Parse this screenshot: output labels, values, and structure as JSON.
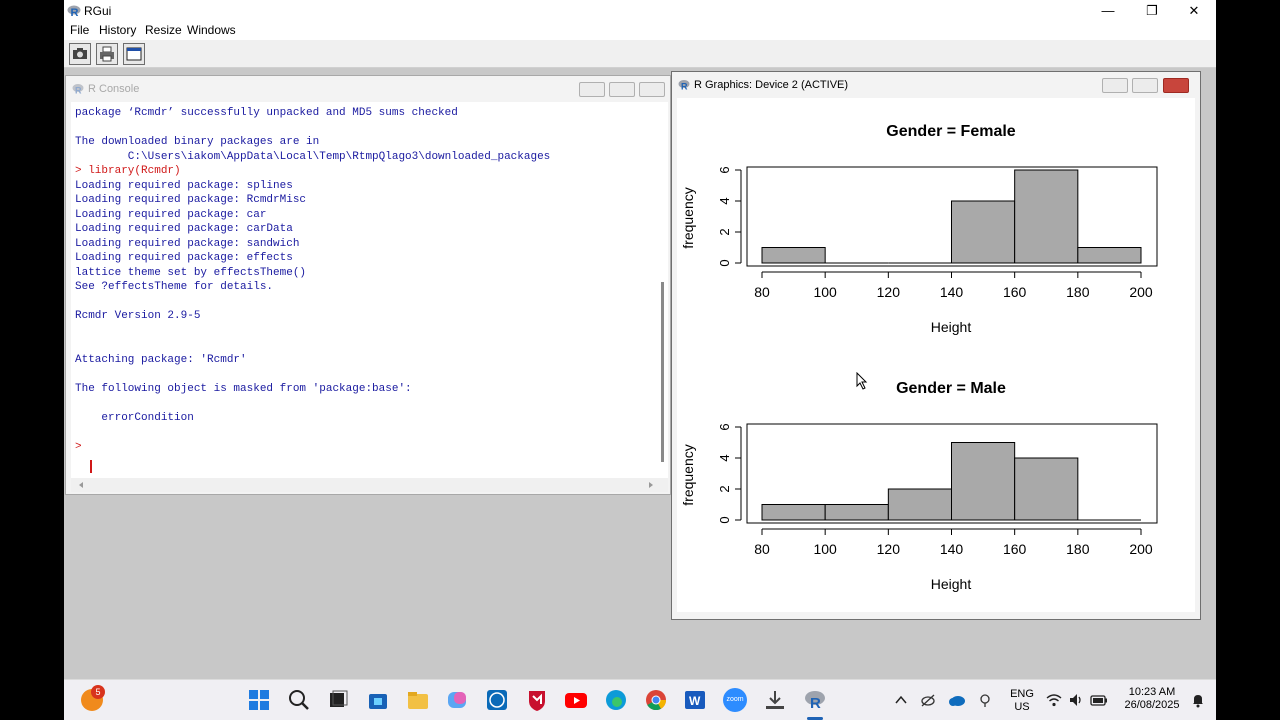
{
  "window": {
    "title": "RGui",
    "minimize": "—",
    "maximize": "❐",
    "close": "✕"
  },
  "menu": [
    "File",
    "History",
    "Resize",
    "Windows"
  ],
  "toolbar": [
    {
      "icon": "open-script-icon"
    },
    {
      "icon": "print-icon"
    },
    {
      "icon": "window-icon"
    }
  ],
  "console": {
    "title": "R Console",
    "lines": [
      {
        "text": "package ‘Rcmdr’ successfully unpacked and MD5 sums checked",
        "color": "blue"
      },
      {
        "text": "",
        "color": "blue"
      },
      {
        "text": "The downloaded binary packages are in",
        "color": "blue"
      },
      {
        "text": "        C:\\Users\\iakom\\AppData\\Local\\Temp\\RtmpQlago3\\downloaded_packages",
        "color": "blue"
      },
      {
        "text": "> library(Rcmdr)",
        "color": "red"
      },
      {
        "text": "Loading required package: splines",
        "color": "blue"
      },
      {
        "text": "Loading required package: RcmdrMisc",
        "color": "blue"
      },
      {
        "text": "Loading required package: car",
        "color": "blue"
      },
      {
        "text": "Loading required package: carData",
        "color": "blue"
      },
      {
        "text": "Loading required package: sandwich",
        "color": "blue"
      },
      {
        "text": "Loading required package: effects",
        "color": "blue"
      },
      {
        "text": "lattice theme set by effectsTheme()",
        "color": "blue"
      },
      {
        "text": "See ?effectsTheme for details.",
        "color": "blue"
      },
      {
        "text": "",
        "color": "blue"
      },
      {
        "text": "Rcmdr Version 2.9-5",
        "color": "blue"
      },
      {
        "text": "",
        "color": "blue"
      },
      {
        "text": "",
        "color": "blue"
      },
      {
        "text": "Attaching package: 'Rcmdr'",
        "color": "blue"
      },
      {
        "text": "",
        "color": "blue"
      },
      {
        "text": "The following object is masked from 'package:base':",
        "color": "blue"
      },
      {
        "text": "",
        "color": "blue"
      },
      {
        "text": "    errorCondition",
        "color": "blue"
      },
      {
        "text": "",
        "color": "blue"
      },
      {
        "text": ">",
        "color": "red"
      }
    ]
  },
  "graphics": {
    "title": "R Graphics: Device 2 (ACTIVE)"
  },
  "chart_data": [
    {
      "type": "bar",
      "title": "Gender = Female",
      "xlabel": "Height",
      "ylabel": "frequency",
      "bin_edges": [
        80,
        100,
        120,
        140,
        160,
        180,
        200
      ],
      "values": [
        1,
        0,
        0,
        4,
        6,
        1
      ],
      "xlim": [
        80,
        200
      ],
      "ylim": [
        0,
        6
      ],
      "xticks": [
        "80",
        "100",
        "120",
        "140",
        "160",
        "180",
        "200"
      ],
      "yticks": [
        "0",
        "2",
        "4",
        "6"
      ]
    },
    {
      "type": "bar",
      "title": "Gender = Male",
      "xlabel": "Height",
      "ylabel": "frequency",
      "bin_edges": [
        80,
        100,
        120,
        140,
        160,
        180,
        200
      ],
      "values": [
        1,
        1,
        2,
        5,
        4,
        0
      ],
      "xlim": [
        80,
        200
      ],
      "ylim": [
        0,
        6
      ],
      "xticks": [
        "80",
        "100",
        "120",
        "140",
        "160",
        "180",
        "200"
      ],
      "yticks": [
        "0",
        "2",
        "4",
        "6"
      ]
    }
  ],
  "taskbar": {
    "notification_badge": "5",
    "apps": [
      "weather-icon",
      "start-icon",
      "search-icon",
      "task-view-icon",
      "store-icon",
      "file-explorer-icon",
      "copilot-icon",
      "dell-icon",
      "mcafee-icon",
      "youtube-icon",
      "edge-icon",
      "chrome-icon",
      "word-icon",
      "zoom-icon",
      "downloads-icon",
      "r-icon"
    ],
    "zoom_label": "zoom",
    "lang_top": "ENG",
    "lang_bottom": "US",
    "time": "10:23 AM",
    "date": "26/08/2025"
  }
}
